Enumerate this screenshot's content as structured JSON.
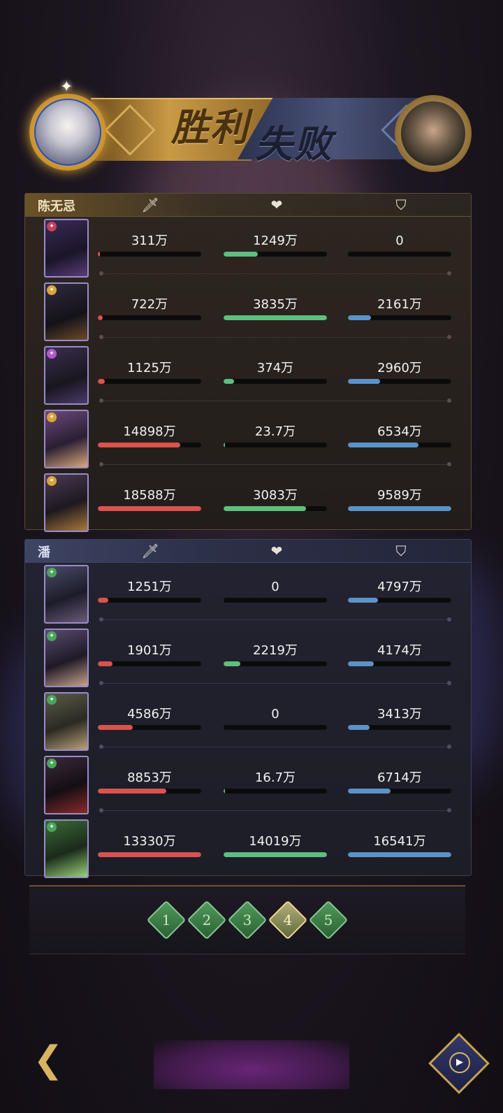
{
  "header": {
    "win_text": "胜利",
    "lose_text": "失败"
  },
  "icons": {
    "damage": "sword-icon",
    "heal": "heart-icon",
    "tank": "shield-icon"
  },
  "teams": [
    {
      "name": "陈无忌",
      "result": "win",
      "rows": [
        {
          "damage": "311万",
          "heal": "1249万",
          "tank": "0",
          "damage_ratio": 0.02,
          "heal_ratio": 0.33,
          "tank_ratio": 0.0
        },
        {
          "damage": "722万",
          "heal": "3835万",
          "tank": "2161万",
          "damage_ratio": 0.05,
          "heal_ratio": 1.0,
          "tank_ratio": 0.22
        },
        {
          "damage": "1125万",
          "heal": "374万",
          "tank": "2960万",
          "damage_ratio": 0.07,
          "heal_ratio": 0.1,
          "tank_ratio": 0.31
        },
        {
          "damage": "14898万",
          "heal": "23.7万",
          "tank": "6534万",
          "damage_ratio": 0.8,
          "heal_ratio": 0.01,
          "tank_ratio": 0.68
        },
        {
          "damage": "18588万",
          "heal": "3083万",
          "tank": "9589万",
          "damage_ratio": 1.0,
          "heal_ratio": 0.8,
          "tank_ratio": 1.0
        }
      ]
    },
    {
      "name": "潘",
      "result": "lose",
      "rows": [
        {
          "damage": "1251万",
          "heal": "0",
          "tank": "4797万",
          "damage_ratio": 0.1,
          "heal_ratio": 0.0,
          "tank_ratio": 0.29
        },
        {
          "damage": "1901万",
          "heal": "2219万",
          "tank": "4174万",
          "damage_ratio": 0.14,
          "heal_ratio": 0.16,
          "tank_ratio": 0.25
        },
        {
          "damage": "4586万",
          "heal": "0",
          "tank": "3413万",
          "damage_ratio": 0.34,
          "heal_ratio": 0.0,
          "tank_ratio": 0.21
        },
        {
          "damage": "8853万",
          "heal": "16.7万",
          "tank": "6714万",
          "damage_ratio": 0.66,
          "heal_ratio": 0.01,
          "tank_ratio": 0.41
        },
        {
          "damage": "13330万",
          "heal": "14019万",
          "tank": "16541万",
          "damage_ratio": 1.0,
          "heal_ratio": 1.0,
          "tank_ratio": 1.0
        }
      ]
    }
  ],
  "pager": {
    "pages": [
      "1",
      "2",
      "3",
      "4",
      "5"
    ],
    "active_index": 3
  },
  "colors": {
    "damage_bar": "#d9534f",
    "heal_bar": "#5fbf7e",
    "tank_bar": "#5b93c8",
    "gold_accent": "#d7ae5c"
  }
}
